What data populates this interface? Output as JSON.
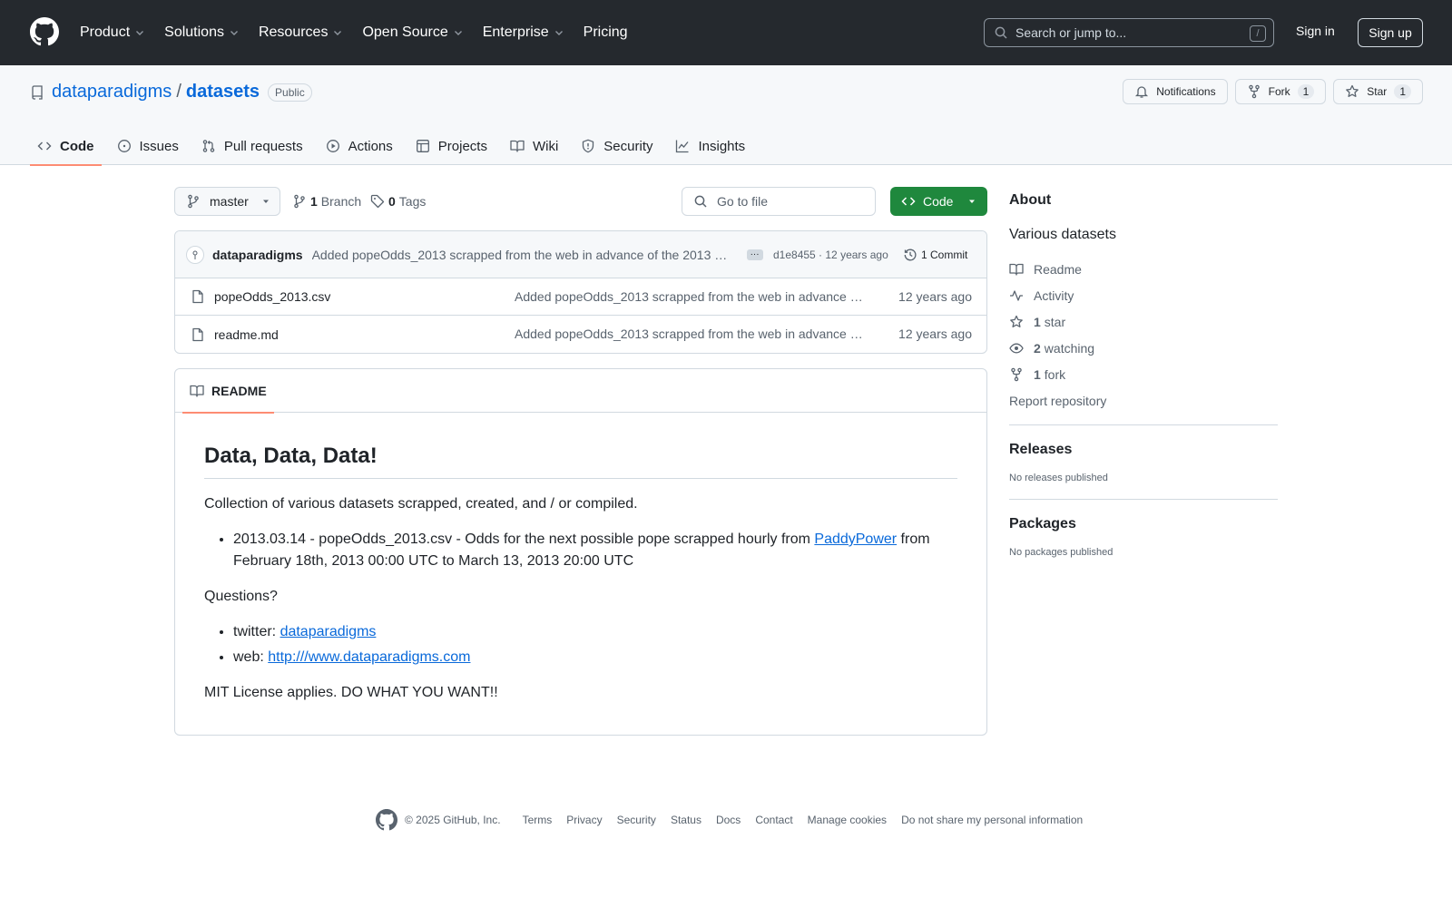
{
  "header": {
    "nav": [
      {
        "label": "Product",
        "dropdown": true
      },
      {
        "label": "Solutions",
        "dropdown": true
      },
      {
        "label": "Resources",
        "dropdown": true
      },
      {
        "label": "Open Source",
        "dropdown": true
      },
      {
        "label": "Enterprise",
        "dropdown": true
      },
      {
        "label": "Pricing",
        "dropdown": false
      }
    ],
    "search_placeholder": "Search or jump to...",
    "search_shortcut": "/",
    "sign_in": "Sign in",
    "sign_up": "Sign up"
  },
  "repo": {
    "owner": "dataparadigms",
    "separator": "/",
    "name": "datasets",
    "visibility": "Public",
    "notifications_label": "Notifications",
    "fork_label": "Fork",
    "fork_count": "1",
    "star_label": "Star",
    "star_count": "1",
    "tabs": [
      "Code",
      "Issues",
      "Pull requests",
      "Actions",
      "Projects",
      "Wiki",
      "Security",
      "Insights"
    ]
  },
  "toolbar": {
    "branch": "master",
    "branch_count": "1",
    "branch_label": "Branch",
    "tag_count": "0",
    "tag_label": "Tags",
    "goto_placeholder": "Go to file",
    "code_label": "Code"
  },
  "commit": {
    "author": "dataparadigms",
    "message": "Added popeOdds_2013 scrapped from the web in advance of the 2013 p…",
    "sha_time": "d1e8455 · 12 years ago",
    "count_label": "1 Commit"
  },
  "files": [
    {
      "name": "popeOdds_2013.csv",
      "message": "Added popeOdds_2013 scrapped from the web in advance …",
      "time": "12 years ago"
    },
    {
      "name": "readme.md",
      "message": "Added popeOdds_2013 scrapped from the web in advance …",
      "time": "12 years ago"
    }
  ],
  "readme": {
    "tab_label": "README",
    "heading": "Data, Data, Data!",
    "intro": "Collection of various datasets scrapped, created, and / or compiled.",
    "item1_pre": "2013.03.14 - popeOdds_2013.csv - Odds for the next possible pope scrapped hourly from ",
    "item1_link": "PaddyPower",
    "item1_post": " from February 18th, 2013 00:00 UTC to March 13, 2013 20:00 UTC",
    "questions": "Questions?",
    "twitter_pre": "twitter: ",
    "twitter_link": "dataparadigms",
    "web_pre": "web: ",
    "web_link": "http:///www.dataparadigms.com",
    "license": "MIT License applies. DO WHAT YOU WANT!!"
  },
  "sidebar": {
    "about_title": "About",
    "description": "Various datasets",
    "readme_label": "Readme",
    "activity_label": "Activity",
    "stars_count": "1",
    "stars_label": "star",
    "watching_count": "2",
    "watching_label": "watching",
    "forks_count": "1",
    "forks_label": "fork",
    "report_label": "Report repository",
    "releases_title": "Releases",
    "releases_text": "No releases published",
    "packages_title": "Packages",
    "packages_text": "No packages published"
  },
  "footer": {
    "copyright": "© 2025 GitHub, Inc.",
    "links": [
      "Terms",
      "Privacy",
      "Security",
      "Status",
      "Docs",
      "Contact",
      "Manage cookies",
      "Do not share my personal information"
    ]
  },
  "colors": {
    "header_bg": "#25292e",
    "link": "#0969da",
    "code_button": "#1f883d",
    "active_tab_underline": "#fd8c73"
  }
}
